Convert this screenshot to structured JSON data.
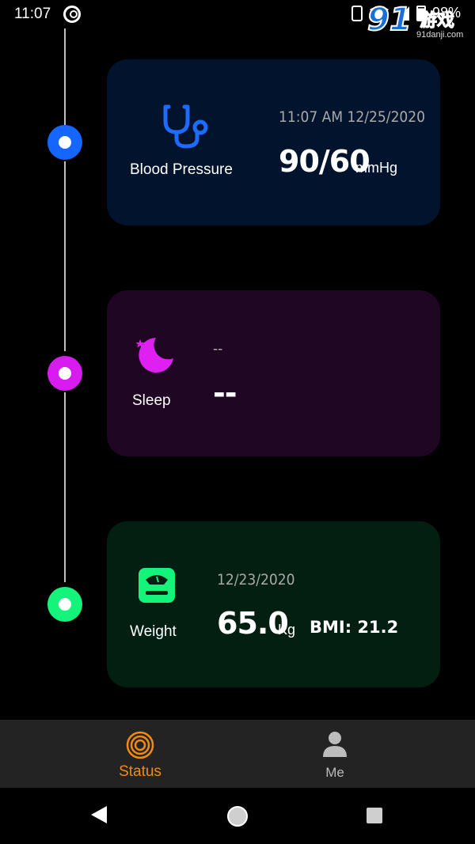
{
  "status_bar": {
    "time": "11:07",
    "battery": "98%",
    "watermark_brand": "91",
    "watermark_cn": "游戏",
    "watermark_url": "91danji.com"
  },
  "colors": {
    "blood_pressure": "#1565ff",
    "sleep": "#d81bef",
    "weight": "#14f47a",
    "nav_active": "#f28a10",
    "nav_inactive": "#bcbcbc"
  },
  "cards": {
    "blood_pressure": {
      "icon": "stethoscope-icon",
      "label": "Blood Pressure",
      "date": "11:07 AM 12/25/2020",
      "value": "90/60",
      "unit": "mmHg"
    },
    "sleep": {
      "icon": "moon-icon",
      "label": "Sleep",
      "date": "--",
      "value": "--"
    },
    "weight": {
      "icon": "scale-icon",
      "label": "Weight",
      "date": "12/23/2020",
      "value": "65.0",
      "unit": "Kg",
      "bmi": "BMI: 21.2"
    }
  },
  "bottom_nav": {
    "items": [
      {
        "label": "Status",
        "icon": "status-rings-icon",
        "active": true
      },
      {
        "label": "Me",
        "icon": "person-icon",
        "active": false
      }
    ]
  }
}
